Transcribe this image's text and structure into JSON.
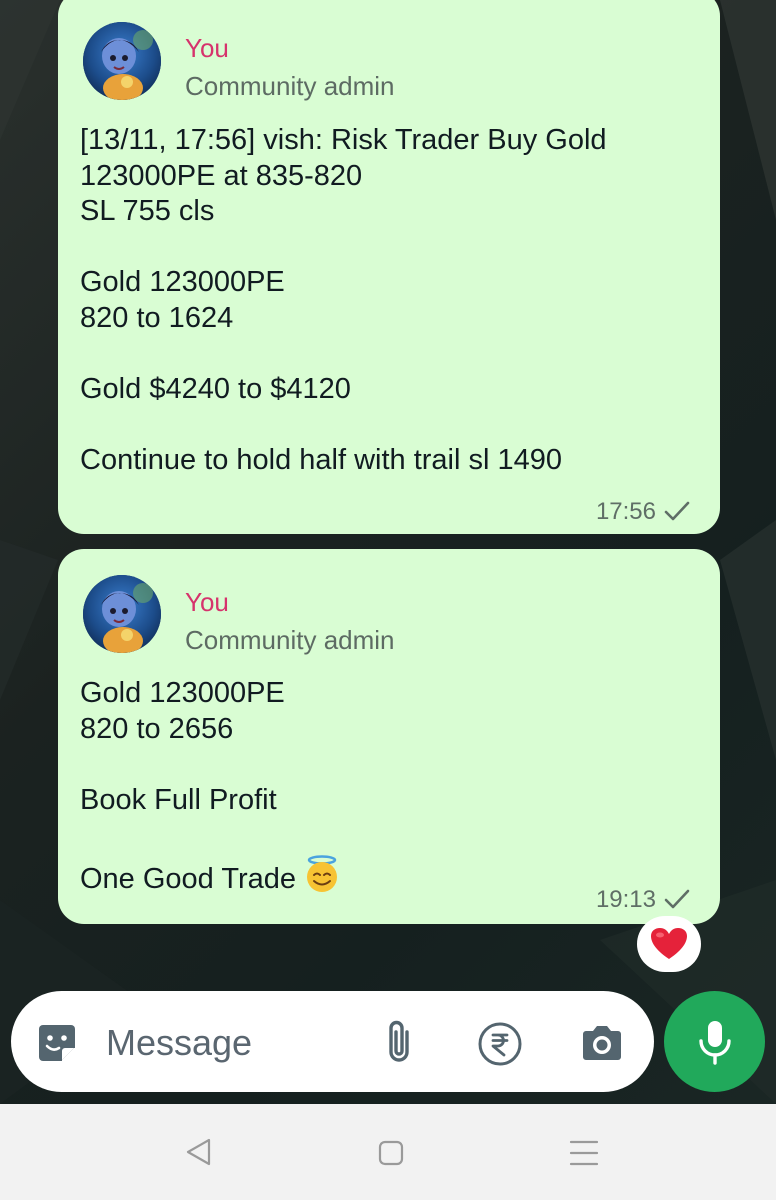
{
  "chat": {
    "messages": [
      {
        "sender": "You",
        "role": "Community admin",
        "text": "[13/11, 17:56] vish: Risk Trader Buy Gold\n123000PE at 835-820\nSL 755 cls\n\nGold 123000PE\n820 to 1624\n\nGold $4240 to $4120\n\nContinue to hold half with trail sl 1490",
        "time": "17:56",
        "status": "sent-check-icon"
      },
      {
        "sender": "You",
        "role": "Community admin",
        "text": "Gold 123000PE\n820 to 2656\n\nBook Full Profit\n\nOne Good Trade",
        "emoji": "smiling-face-with-halo-icon",
        "time": "19:13",
        "status": "sent-check-icon",
        "reaction": "red-heart-icon"
      }
    ]
  },
  "composer": {
    "placeholder": "Message",
    "icons": [
      "sticker-icon",
      "paperclip-icon",
      "rupee-icon",
      "camera-icon",
      "microphone-icon"
    ]
  },
  "navbar": {
    "icons": [
      "back-icon",
      "home-icon",
      "recent-apps-icon"
    ]
  },
  "colors": {
    "bubble": "#d9fdd3",
    "sender_name": "#d6336c",
    "mic_button": "#21a95b",
    "heart": "#e5223a"
  }
}
